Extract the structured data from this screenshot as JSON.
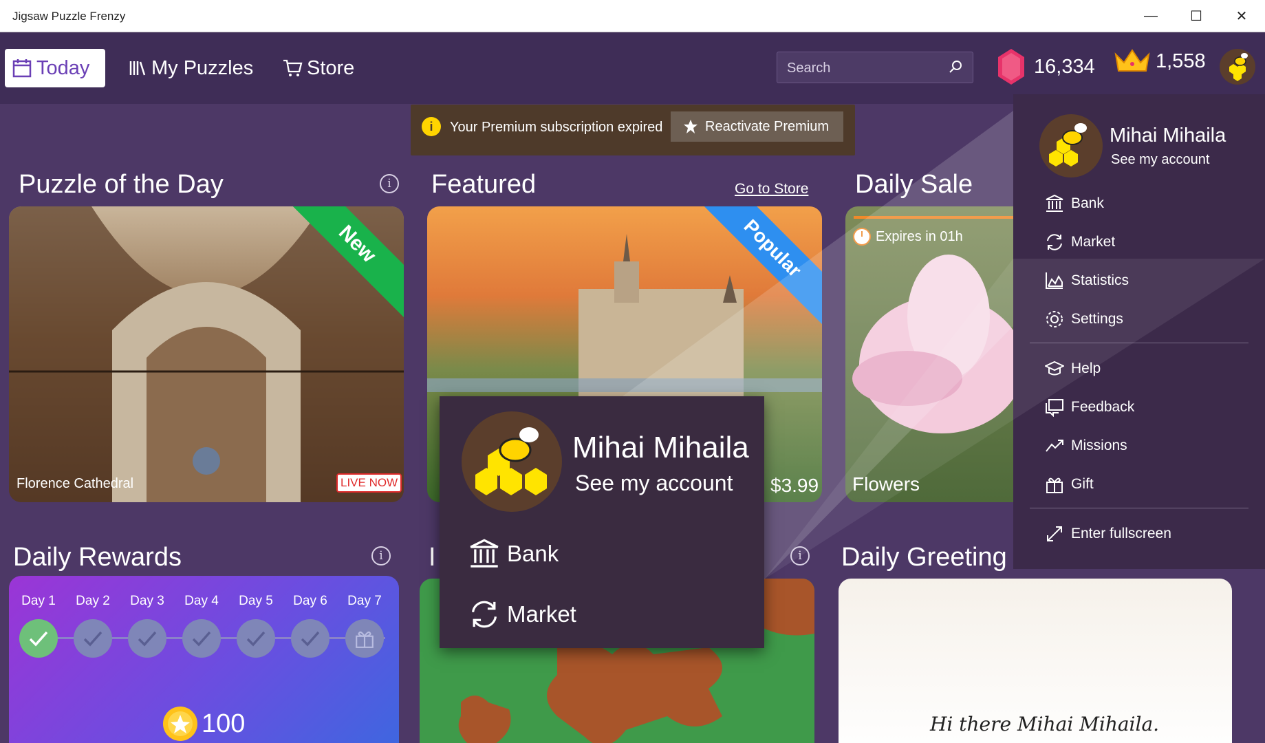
{
  "window": {
    "title": "Jigsaw Puzzle Frenzy"
  },
  "nav": {
    "today": "Today",
    "my_puzzles": "My Puzzles",
    "store": "Store"
  },
  "search": {
    "placeholder": "Search"
  },
  "currency": {
    "gems": "16,334",
    "crowns": "1,558"
  },
  "banner": {
    "message": "Your Premium subscription expired",
    "button": "Reactivate Premium"
  },
  "sections": {
    "puzzle_of_day": {
      "title": "Puzzle of the Day",
      "caption": "Florence Cathedral",
      "badge": "LIVE NOW",
      "ribbon": "New"
    },
    "featured": {
      "title": "Featured",
      "link": "Go to Store",
      "price": "$3.99",
      "ribbon": "Popular"
    },
    "daily_sale": {
      "title": "Daily Sale",
      "expires": "Expires in 01h",
      "caption": "Flowers"
    },
    "daily_rewards": {
      "title": "Daily Rewards",
      "days": [
        "Day 1",
        "Day 2",
        "Day 3",
        "Day 4",
        "Day 5",
        "Day 6",
        "Day 7"
      ],
      "coins": "100"
    },
    "second_row_title_fragment": "I",
    "daily_greeting": {
      "title": "Daily Greeting",
      "text": "Hi there Mihai Mihaila."
    }
  },
  "account_menu": {
    "name": "Mihai Mihaila",
    "sub": "See my account",
    "items": [
      "Bank",
      "Market",
      "Statistics",
      "Settings",
      "Help",
      "Feedback",
      "Missions",
      "Gift",
      "Enter fullscreen"
    ]
  },
  "colors": {
    "accent": "#6a3fb5",
    "gem": "#e7336a",
    "crown": "#ffc21a",
    "live_badge": "#e02a2a",
    "ribbon_new": "#19b24b",
    "ribbon_popular": "#2e8ff0"
  }
}
